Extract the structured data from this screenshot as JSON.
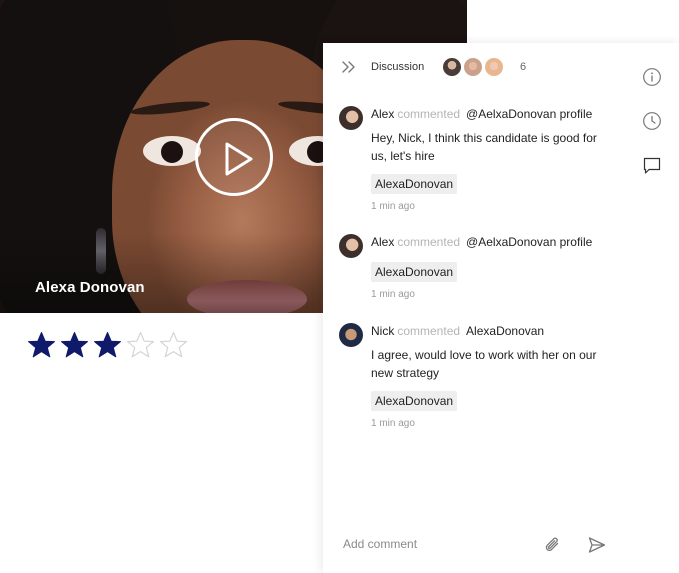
{
  "candidate": {
    "name": "Alexa Donovan",
    "rating": 3,
    "max_rating": 5,
    "star_color": "#0f1a6b"
  },
  "discussion": {
    "title": "Discussion",
    "participant_count": "6",
    "comments": [
      {
        "author": "Alex",
        "verb": "commented",
        "target": "@AelxaDonovan profile",
        "body": "Hey, Nick, I think this candidate is good for us, let's hire",
        "tag": "AlexaDonovan",
        "time": "1 min ago"
      },
      {
        "author": "Alex",
        "verb": "commented",
        "target": "@AelxaDonovan profile",
        "body": "",
        "tag": "AlexaDonovan",
        "time": "1 min ago"
      },
      {
        "author": "Nick",
        "verb": "commented",
        "target": "AlexaDonovan",
        "body": "I agree, would love to work with her on our new strategy",
        "tag": "AlexaDonovan",
        "time": "1 min ago"
      }
    ],
    "input_placeholder": "Add comment"
  },
  "icons": {
    "collapse": "double-chevron-right-icon",
    "info": "info-icon",
    "history": "clock-icon",
    "comments": "chat-bubble-icon",
    "attach": "paperclip-icon",
    "send": "send-icon",
    "play": "play-icon"
  }
}
